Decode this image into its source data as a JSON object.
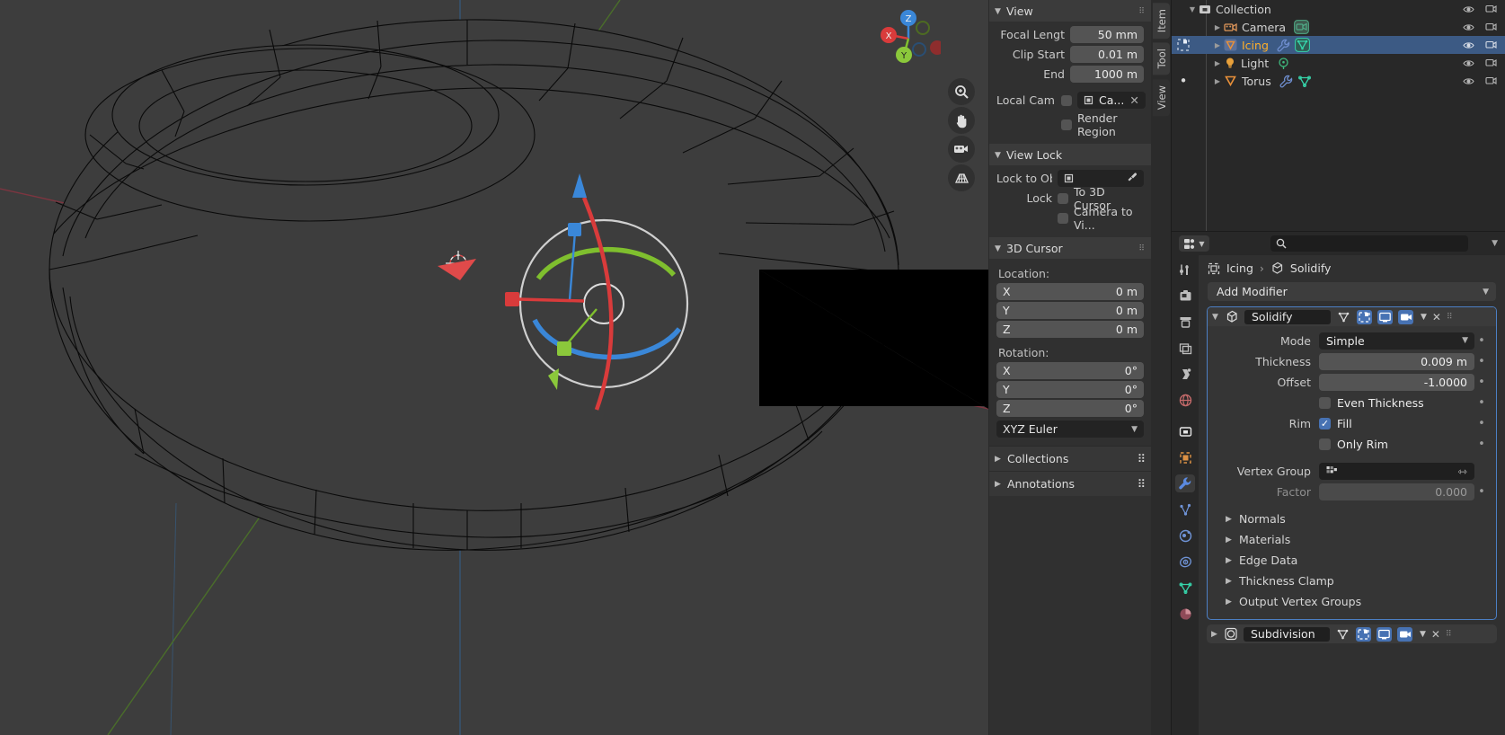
{
  "viewport": {
    "gizmo_axes": [
      "Z",
      "X",
      "Y"
    ],
    "nav_buttons": [
      "zoom-icon",
      "hand-icon",
      "camera-icon",
      "perspective-grid-icon"
    ]
  },
  "sidebar": {
    "tabs": [
      "Item",
      "Tool",
      "View"
    ],
    "active_tab": "View",
    "view_panel": {
      "title": "View",
      "focal_length_label": "Focal Lengt",
      "focal_length_value": "50 mm",
      "clip_start_label": "Clip Start",
      "clip_start_value": "0.01 m",
      "clip_end_label": "End",
      "clip_end_value": "1000 m",
      "local_camera_label": "Local Cam...",
      "local_camera_value": "Ca...",
      "render_region_label": "Render Region"
    },
    "view_lock_panel": {
      "title": "View Lock",
      "lock_to_obj_label": "Lock to Obj",
      "lock_label": "Lock",
      "to_3d_cursor_label": "To 3D Cursor",
      "camera_to_view_label": "Camera to Vi..."
    },
    "cursor_panel": {
      "title": "3D Cursor",
      "location_label": "Location:",
      "location": [
        {
          "axis": "X",
          "value": "0 m"
        },
        {
          "axis": "Y",
          "value": "0 m"
        },
        {
          "axis": "Z",
          "value": "0 m"
        }
      ],
      "rotation_label": "Rotation:",
      "rotation": [
        {
          "axis": "X",
          "value": "0°"
        },
        {
          "axis": "Y",
          "value": "0°"
        },
        {
          "axis": "Z",
          "value": "0°"
        }
      ],
      "rotation_mode": "XYZ Euler"
    },
    "collapsed": [
      "Collections",
      "Annotations"
    ]
  },
  "outliner": {
    "rows": [
      {
        "name": "Collection",
        "icon": "collection-icon",
        "indent": 0,
        "selected": false,
        "expand": "▼",
        "active": false,
        "dot": false,
        "icons": [],
        "eye": false
      },
      {
        "name": "Camera",
        "icon": "camera-data-icon",
        "indent": 1,
        "selected": false,
        "expand": "▶",
        "active": false,
        "dot": false,
        "icons": [
          "camera-data-icon"
        ],
        "eye": true
      },
      {
        "name": "Icing",
        "icon": "mesh-icon",
        "indent": 1,
        "selected": true,
        "expand": "▶",
        "active": true,
        "dot": false,
        "icons": [
          "wrench-icon",
          "mesh-data-icon"
        ],
        "eye": true
      },
      {
        "name": "Light",
        "icon": "light-icon",
        "indent": 1,
        "selected": false,
        "expand": "▶",
        "active": false,
        "dot": false,
        "icons": [
          "light-data-icon"
        ],
        "eye": true
      },
      {
        "name": "Torus",
        "icon": "mesh-icon",
        "indent": 1,
        "selected": false,
        "expand": "▶",
        "active": false,
        "dot": true,
        "icons": [
          "wrench-icon",
          "mesh-data-icon"
        ],
        "eye": true
      }
    ]
  },
  "properties": {
    "search_placeholder": "",
    "breadcrumb": {
      "object": "Icing",
      "separator": "›",
      "modifier": "Solidify"
    },
    "add_modifier_label": "Add Modifier",
    "tabs": [
      "tool-icon",
      "render-icon",
      "output-icon",
      "view-layer-icon",
      "scene-icon",
      "world-icon",
      "collection-icon",
      "object-icon",
      "modifier-icon",
      "particles-icon",
      "physics-icon",
      "constraints-icon",
      "data-icon",
      "material-icon"
    ],
    "active_tab": "modifier-icon",
    "modifiers": [
      {
        "name": "Solidify",
        "expanded": true,
        "header_icons": [
          "edit-mode-icon",
          "realtime-icon",
          "render-icon",
          "camera-icon"
        ],
        "fields": [
          {
            "kind": "enum",
            "label": "Mode",
            "value": "Simple"
          },
          {
            "kind": "value",
            "label": "Thickness",
            "value": "0.009 m"
          },
          {
            "kind": "value",
            "label": "Offset",
            "value": "-1.0000"
          },
          {
            "kind": "check",
            "label": "",
            "value": "Even Thickness",
            "checked": false
          },
          {
            "kind": "check",
            "label": "Rim",
            "value": "Fill",
            "checked": true
          },
          {
            "kind": "check",
            "label": "",
            "value": "Only Rim",
            "checked": false
          },
          {
            "kind": "vgroup",
            "label": "Vertex Group",
            "value": ""
          },
          {
            "kind": "dim",
            "label": "Factor",
            "value": "0.000"
          }
        ],
        "subpanels": [
          "Normals",
          "Materials",
          "Edge Data",
          "Thickness Clamp",
          "Output Vertex Groups"
        ]
      },
      {
        "name": "Subdivision",
        "expanded": false,
        "header_icons": [
          "edit-mode-icon",
          "realtime-icon",
          "render-icon",
          "camera-icon"
        ],
        "fields": [],
        "subpanels": []
      }
    ]
  },
  "colors": {
    "accent_blue": "#4772b3",
    "outliner_select": "#3c5a84",
    "active_object_text": "#ffaf29",
    "axis_x": "#e04a4a",
    "axis_y": "#8bc83b",
    "axis_z": "#3a87d8",
    "viewport_bg": "#3d3d3d"
  }
}
